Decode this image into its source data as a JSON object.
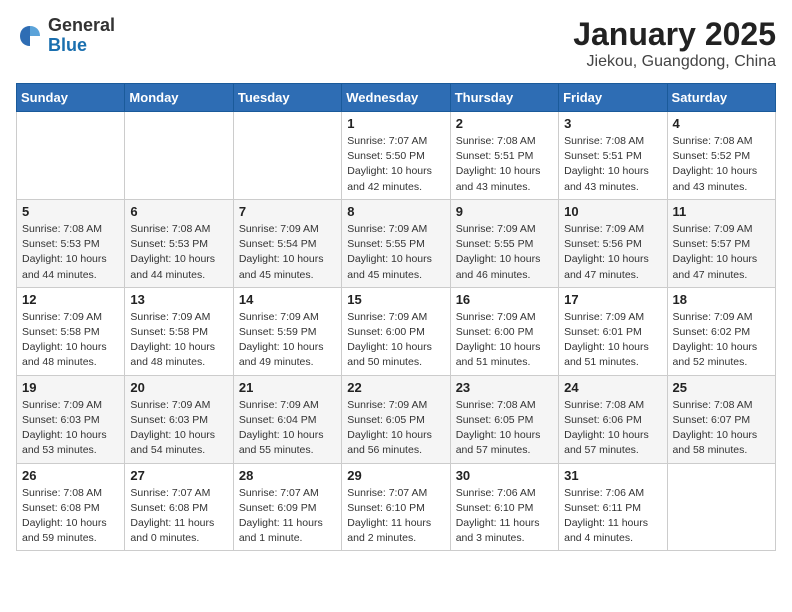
{
  "header": {
    "logo_general": "General",
    "logo_blue": "Blue",
    "title": "January 2025",
    "subtitle": "Jiekou, Guangdong, China"
  },
  "weekdays": [
    "Sunday",
    "Monday",
    "Tuesday",
    "Wednesday",
    "Thursday",
    "Friday",
    "Saturday"
  ],
  "weeks": [
    [
      {
        "day": "",
        "info": ""
      },
      {
        "day": "",
        "info": ""
      },
      {
        "day": "",
        "info": ""
      },
      {
        "day": "1",
        "info": "Sunrise: 7:07 AM\nSunset: 5:50 PM\nDaylight: 10 hours\nand 42 minutes."
      },
      {
        "day": "2",
        "info": "Sunrise: 7:08 AM\nSunset: 5:51 PM\nDaylight: 10 hours\nand 43 minutes."
      },
      {
        "day": "3",
        "info": "Sunrise: 7:08 AM\nSunset: 5:51 PM\nDaylight: 10 hours\nand 43 minutes."
      },
      {
        "day": "4",
        "info": "Sunrise: 7:08 AM\nSunset: 5:52 PM\nDaylight: 10 hours\nand 43 minutes."
      }
    ],
    [
      {
        "day": "5",
        "info": "Sunrise: 7:08 AM\nSunset: 5:53 PM\nDaylight: 10 hours\nand 44 minutes."
      },
      {
        "day": "6",
        "info": "Sunrise: 7:08 AM\nSunset: 5:53 PM\nDaylight: 10 hours\nand 44 minutes."
      },
      {
        "day": "7",
        "info": "Sunrise: 7:09 AM\nSunset: 5:54 PM\nDaylight: 10 hours\nand 45 minutes."
      },
      {
        "day": "8",
        "info": "Sunrise: 7:09 AM\nSunset: 5:55 PM\nDaylight: 10 hours\nand 45 minutes."
      },
      {
        "day": "9",
        "info": "Sunrise: 7:09 AM\nSunset: 5:55 PM\nDaylight: 10 hours\nand 46 minutes."
      },
      {
        "day": "10",
        "info": "Sunrise: 7:09 AM\nSunset: 5:56 PM\nDaylight: 10 hours\nand 47 minutes."
      },
      {
        "day": "11",
        "info": "Sunrise: 7:09 AM\nSunset: 5:57 PM\nDaylight: 10 hours\nand 47 minutes."
      }
    ],
    [
      {
        "day": "12",
        "info": "Sunrise: 7:09 AM\nSunset: 5:58 PM\nDaylight: 10 hours\nand 48 minutes."
      },
      {
        "day": "13",
        "info": "Sunrise: 7:09 AM\nSunset: 5:58 PM\nDaylight: 10 hours\nand 48 minutes."
      },
      {
        "day": "14",
        "info": "Sunrise: 7:09 AM\nSunset: 5:59 PM\nDaylight: 10 hours\nand 49 minutes."
      },
      {
        "day": "15",
        "info": "Sunrise: 7:09 AM\nSunset: 6:00 PM\nDaylight: 10 hours\nand 50 minutes."
      },
      {
        "day": "16",
        "info": "Sunrise: 7:09 AM\nSunset: 6:00 PM\nDaylight: 10 hours\nand 51 minutes."
      },
      {
        "day": "17",
        "info": "Sunrise: 7:09 AM\nSunset: 6:01 PM\nDaylight: 10 hours\nand 51 minutes."
      },
      {
        "day": "18",
        "info": "Sunrise: 7:09 AM\nSunset: 6:02 PM\nDaylight: 10 hours\nand 52 minutes."
      }
    ],
    [
      {
        "day": "19",
        "info": "Sunrise: 7:09 AM\nSunset: 6:03 PM\nDaylight: 10 hours\nand 53 minutes."
      },
      {
        "day": "20",
        "info": "Sunrise: 7:09 AM\nSunset: 6:03 PM\nDaylight: 10 hours\nand 54 minutes."
      },
      {
        "day": "21",
        "info": "Sunrise: 7:09 AM\nSunset: 6:04 PM\nDaylight: 10 hours\nand 55 minutes."
      },
      {
        "day": "22",
        "info": "Sunrise: 7:09 AM\nSunset: 6:05 PM\nDaylight: 10 hours\nand 56 minutes."
      },
      {
        "day": "23",
        "info": "Sunrise: 7:08 AM\nSunset: 6:05 PM\nDaylight: 10 hours\nand 57 minutes."
      },
      {
        "day": "24",
        "info": "Sunrise: 7:08 AM\nSunset: 6:06 PM\nDaylight: 10 hours\nand 57 minutes."
      },
      {
        "day": "25",
        "info": "Sunrise: 7:08 AM\nSunset: 6:07 PM\nDaylight: 10 hours\nand 58 minutes."
      }
    ],
    [
      {
        "day": "26",
        "info": "Sunrise: 7:08 AM\nSunset: 6:08 PM\nDaylight: 10 hours\nand 59 minutes."
      },
      {
        "day": "27",
        "info": "Sunrise: 7:07 AM\nSunset: 6:08 PM\nDaylight: 11 hours\nand 0 minutes."
      },
      {
        "day": "28",
        "info": "Sunrise: 7:07 AM\nSunset: 6:09 PM\nDaylight: 11 hours\nand 1 minute."
      },
      {
        "day": "29",
        "info": "Sunrise: 7:07 AM\nSunset: 6:10 PM\nDaylight: 11 hours\nand 2 minutes."
      },
      {
        "day": "30",
        "info": "Sunrise: 7:06 AM\nSunset: 6:10 PM\nDaylight: 11 hours\nand 3 minutes."
      },
      {
        "day": "31",
        "info": "Sunrise: 7:06 AM\nSunset: 6:11 PM\nDaylight: 11 hours\nand 4 minutes."
      },
      {
        "day": "",
        "info": ""
      }
    ]
  ]
}
